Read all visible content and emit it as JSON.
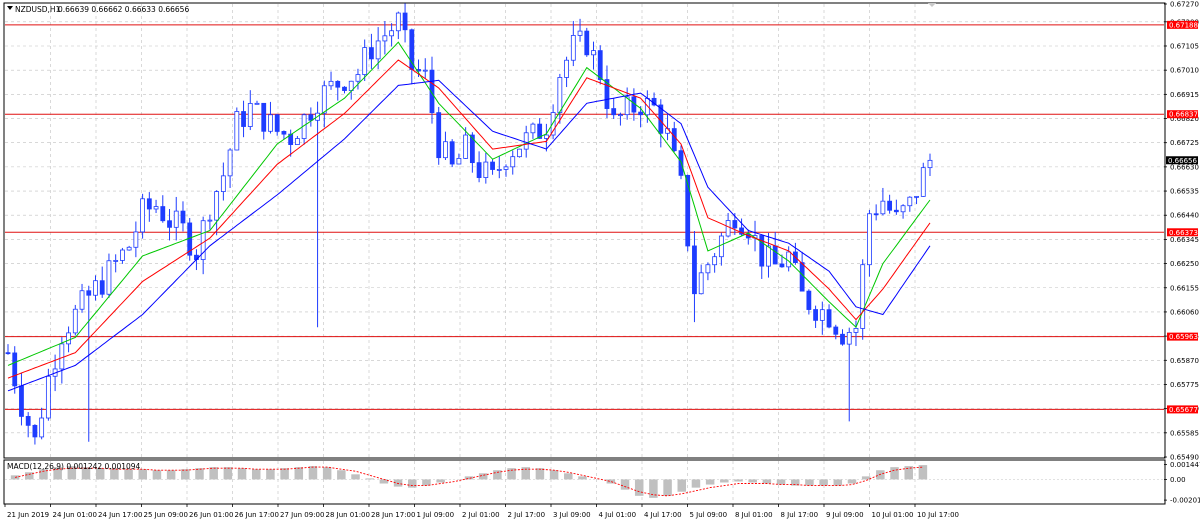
{
  "header": {
    "symbol_label": "NZDUSD,H1",
    "ohlc_label": "0.66639 0.66662 0.66633 0.66656",
    "macd_label": "MACD(12,26,9) 0.001242 0.001094"
  },
  "colors": {
    "background": "#ffffff",
    "grid": "#c0c0c0",
    "candle": "#1e3cff",
    "ma_fast": "#00c800",
    "ma_mid": "#ff0000",
    "ma_slow": "#0000ff",
    "level_line": "#e01010",
    "level_label_bg": "#ff0000",
    "current_price_bg": "#000000",
    "macd_hist": "#c0c0c0",
    "macd_signal": "#ff0000"
  },
  "chart_data": [
    {
      "type": "candlestick",
      "title": "NZDUSD,H1",
      "ylim": [
        0.6549,
        0.6727
      ],
      "grid": true,
      "yticks": [
        "0.67270",
        "0.67200",
        "0.67105",
        "0.67010",
        "0.66915",
        "0.66820",
        "0.66725",
        "0.66630",
        "0.66535",
        "0.66440",
        "0.66345",
        "0.66250",
        "0.66155",
        "0.66060",
        "0.65965",
        "0.65870",
        "0.65775",
        "0.65680",
        "0.65585",
        "0.65490"
      ],
      "xticks": [
        "21 Jun 2019",
        "24 Jun 01:00",
        "24 Jun 17:00",
        "25 Jun 09:00",
        "26 Jun 01:00",
        "26 Jun 17:00",
        "27 Jun 09:00",
        "28 Jun 01:00",
        "28 Jun 17:00",
        "1 Jul 09:00",
        "2 Jul 01:00",
        "2 Jul 17:00",
        "3 Jul 09:00",
        "4 Jul 01:00",
        "4 Jul 17:00",
        "5 Jul 09:00",
        "8 Jul 01:00",
        "8 Jul 17:00",
        "9 Jul 09:00",
        "10 Jul 01:00",
        "10 Jul 17:00"
      ],
      "levels": [
        "0.67188",
        "0.66837",
        "0.66373",
        "0.65963",
        "0.65677"
      ],
      "current_price": "0.66656",
      "close_path": [
        [
          0,
          0.659
        ],
        [
          2,
          0.657
        ],
        [
          4,
          0.6555
        ],
        [
          6,
          0.658
        ],
        [
          8,
          0.6598
        ],
        [
          10,
          0.6605
        ],
        [
          12,
          0.6612
        ],
        [
          14,
          0.6618
        ],
        [
          16,
          0.6625
        ],
        [
          18,
          0.6632
        ],
        [
          20,
          0.6645
        ],
        [
          22,
          0.6648
        ],
        [
          24,
          0.6642
        ],
        [
          26,
          0.6638
        ],
        [
          28,
          0.663
        ],
        [
          30,
          0.6648
        ],
        [
          32,
          0.666
        ],
        [
          34,
          0.668
        ],
        [
          36,
          0.6686
        ],
        [
          38,
          0.6682
        ],
        [
          40,
          0.6677
        ],
        [
          42,
          0.6675
        ],
        [
          44,
          0.6682
        ],
        [
          46,
          0.669
        ],
        [
          48,
          0.6694
        ],
        [
          50,
          0.6698
        ],
        [
          52,
          0.67
        ],
        [
          54,
          0.671
        ],
        [
          56,
          0.6715
        ],
        [
          58,
          0.672
        ],
        [
          60,
          0.6702
        ],
        [
          62,
          0.6698
        ],
        [
          64,
          0.6672
        ],
        [
          66,
          0.6662
        ],
        [
          68,
          0.667
        ],
        [
          70,
          0.6662
        ],
        [
          72,
          0.6658
        ],
        [
          74,
          0.6668
        ],
        [
          76,
          0.6672
        ],
        [
          78,
          0.6675
        ],
        [
          80,
          0.668
        ],
        [
          82,
          0.67
        ],
        [
          84,
          0.671
        ],
        [
          86,
          0.6712
        ],
        [
          88,
          0.67
        ],
        [
          90,
          0.668
        ],
        [
          92,
          0.6685
        ],
        [
          94,
          0.6688
        ],
        [
          96,
          0.6686
        ],
        [
          98,
          0.6675
        ],
        [
          100,
          0.6655
        ],
        [
          102,
          0.6615
        ],
        [
          104,
          0.6625
        ],
        [
          106,
          0.6635
        ],
        [
          108,
          0.6645
        ],
        [
          110,
          0.664
        ],
        [
          112,
          0.6628
        ],
        [
          114,
          0.6624
        ],
        [
          116,
          0.6628
        ],
        [
          118,
          0.6612
        ],
        [
          120,
          0.6608
        ],
        [
          122,
          0.6605
        ],
        [
          124,
          0.6598
        ],
        [
          126,
          0.66
        ],
        [
          128,
          0.6645
        ],
        [
          130,
          0.665
        ],
        [
          132,
          0.6642
        ],
        [
          134,
          0.6648
        ],
        [
          136,
          0.666
        ],
        [
          137,
          0.66656
        ]
      ],
      "series": [
        {
          "name": "",
          "kind": "ma_fast",
          "values": [
            [
              0,
              0.6585
            ],
            [
              10,
              0.6596
            ],
            [
              20,
              0.6628
            ],
            [
              30,
              0.6638
            ],
            [
              40,
              0.6672
            ],
            [
              50,
              0.669
            ],
            [
              58,
              0.6712
            ],
            [
              64,
              0.6688
            ],
            [
              72,
              0.6666
            ],
            [
              80,
              0.6676
            ],
            [
              86,
              0.6702
            ],
            [
              94,
              0.6686
            ],
            [
              100,
              0.6665
            ],
            [
              104,
              0.663
            ],
            [
              110,
              0.6637
            ],
            [
              116,
              0.6626
            ],
            [
              122,
              0.661
            ],
            [
              126,
              0.66
            ],
            [
              130,
              0.6625
            ],
            [
              137,
              0.665
            ]
          ]
        },
        {
          "name": "",
          "kind": "ma_mid",
          "values": [
            [
              0,
              0.658
            ],
            [
              10,
              0.659
            ],
            [
              20,
              0.6618
            ],
            [
              30,
              0.6635
            ],
            [
              40,
              0.6664
            ],
            [
              50,
              0.6684
            ],
            [
              58,
              0.6705
            ],
            [
              64,
              0.6694
            ],
            [
              72,
              0.667
            ],
            [
              80,
              0.6673
            ],
            [
              86,
              0.6698
            ],
            [
              94,
              0.669
            ],
            [
              100,
              0.6672
            ],
            [
              104,
              0.6643
            ],
            [
              110,
              0.6636
            ],
            [
              116,
              0.663
            ],
            [
              122,
              0.6615
            ],
            [
              126,
              0.6603
            ],
            [
              130,
              0.6615
            ],
            [
              137,
              0.6641
            ]
          ]
        },
        {
          "name": "",
          "kind": "ma_slow",
          "values": [
            [
              0,
              0.6575
            ],
            [
              10,
              0.6585
            ],
            [
              20,
              0.6605
            ],
            [
              30,
              0.6632
            ],
            [
              40,
              0.6652
            ],
            [
              50,
              0.6674
            ],
            [
              58,
              0.6695
            ],
            [
              64,
              0.6697
            ],
            [
              72,
              0.6677
            ],
            [
              80,
              0.667
            ],
            [
              86,
              0.6688
            ],
            [
              94,
              0.6692
            ],
            [
              100,
              0.668
            ],
            [
              104,
              0.6655
            ],
            [
              110,
              0.6638
            ],
            [
              116,
              0.6633
            ],
            [
              122,
              0.6622
            ],
            [
              126,
              0.6608
            ],
            [
              130,
              0.6605
            ],
            [
              137,
              0.6632
            ]
          ]
        }
      ]
    },
    {
      "type": "macd",
      "title": "MACD(12,26,9) 0.001242 0.001094",
      "ylim": [
        -0.0023,
        0.0018
      ],
      "yticks": [
        "0.001447",
        "0.00",
        "-0.002017"
      ],
      "histogram": [
        0.0004,
        0.0007,
        0.001,
        0.0012,
        0.0013,
        0.0012,
        0.0011,
        0.0011,
        0.001,
        0.001,
        0.0009,
        0.0009,
        0.001,
        0.0011,
        0.0012,
        0.0012,
        0.0011,
        0.001,
        0.001,
        0.0011,
        0.0012,
        0.0013,
        0.0012,
        0.0009,
        0.0005,
        0.0001,
        -0.0004,
        -0.0007,
        -0.0008,
        -0.0006,
        -0.0003,
        0.0,
        0.0003,
        0.0006,
        0.0009,
        0.0011,
        0.0012,
        0.0011,
        0.0009,
        0.0006,
        0.0003,
        0.0,
        -0.0004,
        -0.001,
        -0.0016,
        -0.0018,
        -0.0016,
        -0.0012,
        -0.0008,
        -0.0005,
        -0.0003,
        -0.0002,
        -0.0003,
        -0.0004,
        -0.0005,
        -0.0006,
        -0.0006,
        -0.0006,
        -0.0006,
        -0.0004,
        0.0003,
        0.0009,
        0.0012,
        0.0013,
        0.0014
      ],
      "signal": [
        0.0002,
        0.0005,
        0.0008,
        0.001,
        0.0011,
        0.0011,
        0.0011,
        0.001,
        0.001,
        0.001,
        0.0009,
        0.0009,
        0.0009,
        0.001,
        0.0011,
        0.0011,
        0.0011,
        0.001,
        0.001,
        0.001,
        0.0011,
        0.0012,
        0.0012,
        0.001,
        0.0008,
        0.0004,
        0.0,
        -0.0004,
        -0.0006,
        -0.0006,
        -0.0004,
        -0.0002,
        0.0001,
        0.0004,
        0.0007,
        0.0009,
        0.001,
        0.001,
        0.0009,
        0.0007,
        0.0004,
        0.0001,
        -0.0002,
        -0.0007,
        -0.0012,
        -0.0015,
        -0.0016,
        -0.0014,
        -0.0011,
        -0.0008,
        -0.0006,
        -0.0004,
        -0.0004,
        -0.0004,
        -0.0005,
        -0.0005,
        -0.0006,
        -0.0006,
        -0.0006,
        -0.0005,
        -0.0001,
        0.0005,
        0.0009,
        0.0011,
        0.0012
      ]
    }
  ]
}
